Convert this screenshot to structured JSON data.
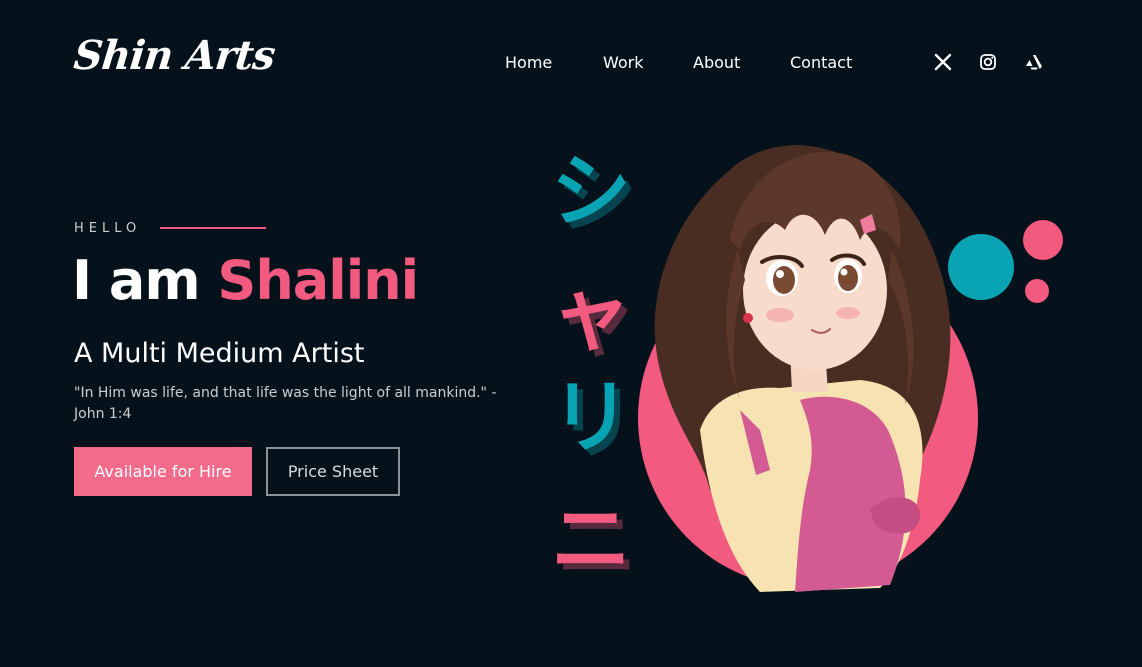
{
  "header": {
    "logo": "Shin Arts",
    "nav": [
      {
        "label": "Home"
      },
      {
        "label": "Work"
      },
      {
        "label": "About"
      },
      {
        "label": "Contact"
      }
    ],
    "social_icons": [
      "x-icon",
      "instagram-icon",
      "artstation-icon"
    ]
  },
  "hero": {
    "eyebrow": "HELLO",
    "headline_prefix": "I am",
    "headline_name": "Shalini",
    "subtitle": "A Multi Medium Artist",
    "quote": "\"In Him was life, and that life was the light of all mankind.\" - John 1:4",
    "primary_button": "Available for Hire",
    "secondary_button": "Price Sheet"
  },
  "artwork": {
    "katakana": [
      "シ",
      "ャ",
      "リ",
      "ニ"
    ],
    "illustration": "anime-girl-portrait"
  },
  "colors": {
    "background": "#06121b",
    "accent_pink": "#f25a7f",
    "accent_teal": "#08a4b3",
    "text": "#ffffff",
    "muted_text": "#c9ced3"
  }
}
